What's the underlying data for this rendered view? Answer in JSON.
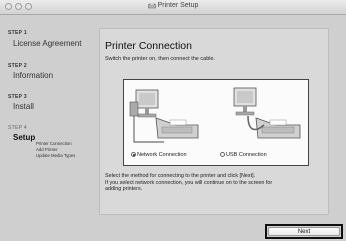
{
  "window": {
    "title": "Printer Setup"
  },
  "sidebar": {
    "steps": [
      {
        "number": "STEP 1",
        "name": "License Agreement"
      },
      {
        "number": "STEP 2",
        "name": "Information"
      },
      {
        "number": "STEP 3",
        "name": "Install"
      },
      {
        "number": "STEP 4",
        "name": "Setup"
      }
    ],
    "substeps": [
      "Printer Connection",
      "Add Printer",
      "Update Media Types"
    ]
  },
  "main": {
    "heading": "Printer Connection",
    "instruction": "Switch the printer on, then connect the cable.",
    "options": [
      {
        "label": "Network Connection",
        "selected": true
      },
      {
        "label": "USB Connection",
        "selected": false
      }
    ],
    "description_line1": "Select the method for connecting to the printer and click [Next].",
    "description_line2": "If you select network connection, you will continue on to the screen for",
    "description_line3": "adding printers."
  },
  "footer": {
    "next_label": "Next"
  }
}
